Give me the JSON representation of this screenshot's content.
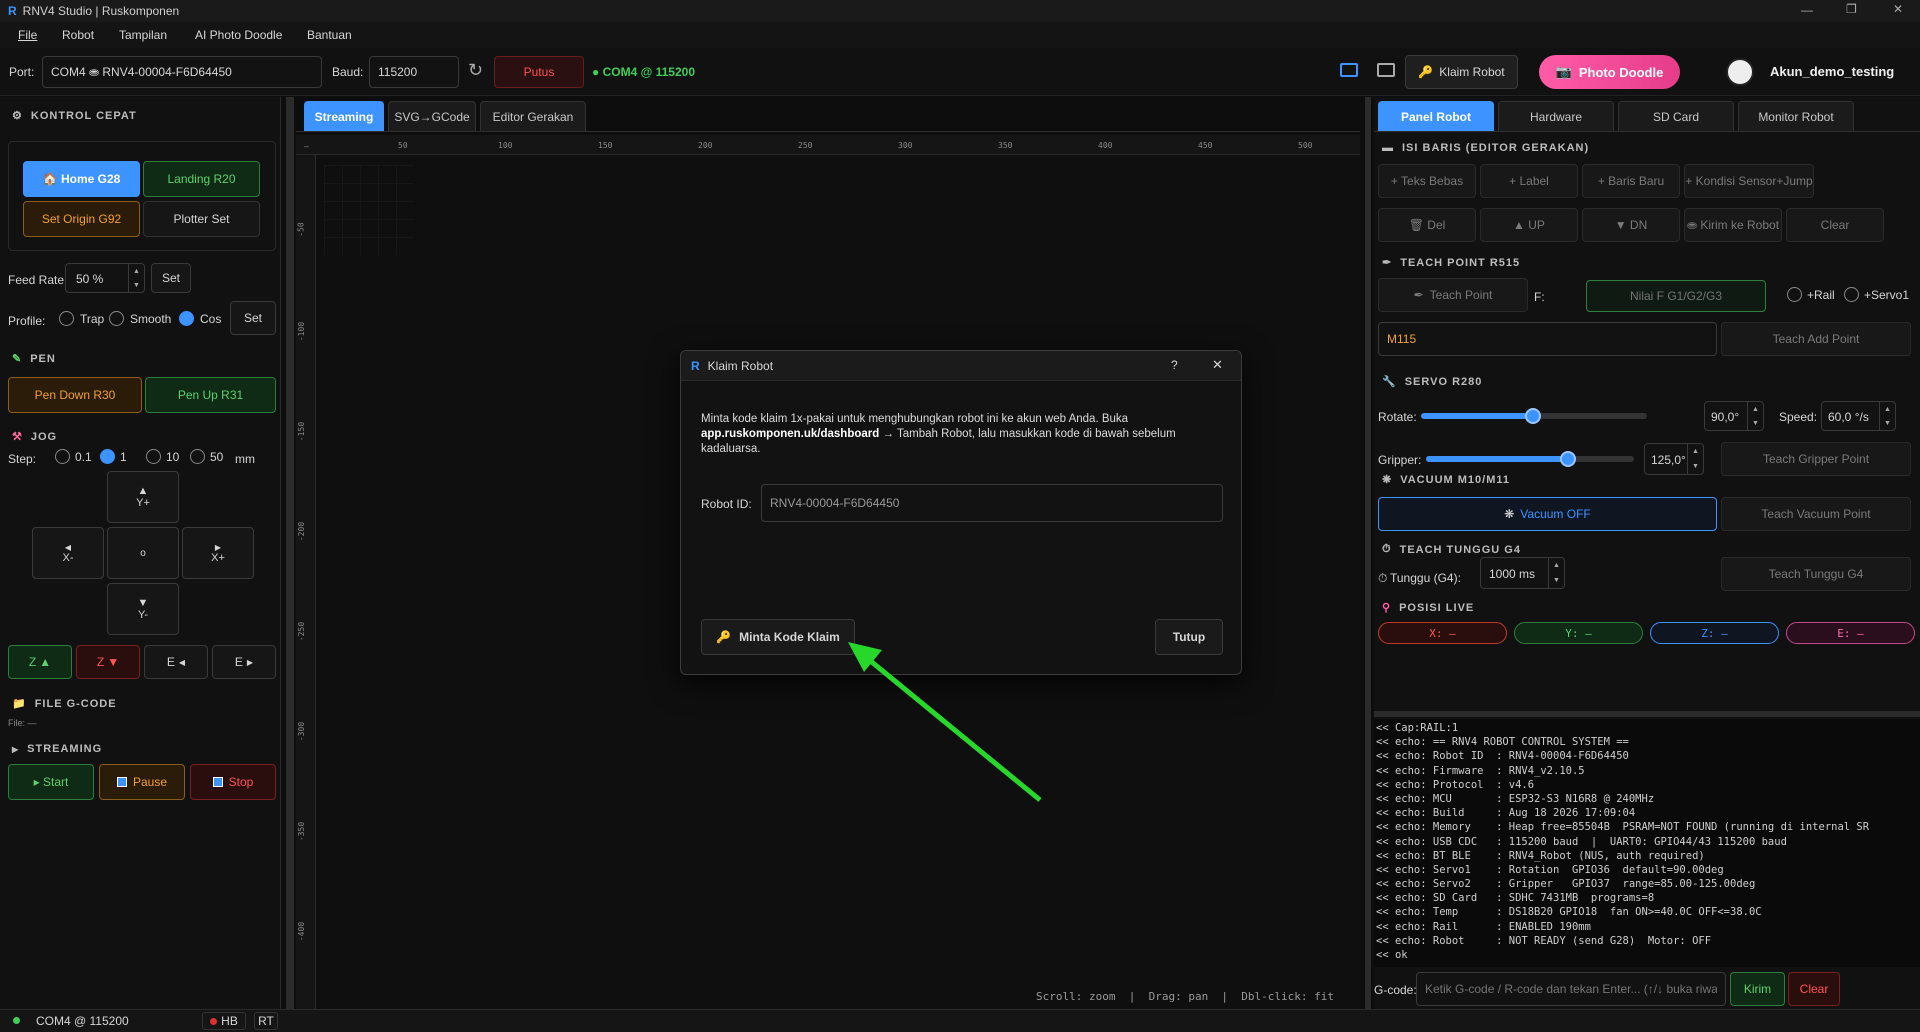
{
  "window": {
    "title": "RNV4 Studio | Ruskomponen"
  },
  "menu": [
    "File",
    "Robot",
    "Tampilan",
    "AI Photo Doodle",
    "Bantuan"
  ],
  "toolbar": {
    "port_label": "Port:",
    "port_value": "COM4  ⛂ RNV4-00004-F6D64450",
    "baud_label": "Baud:",
    "baud_value": "115200",
    "disconnect": "Putus",
    "status": "● COM4 @ 115200",
    "claim": "Klaim Robot",
    "doodle": "Photo Doodle",
    "account": "Akun_demo_testing"
  },
  "left": {
    "quick": "KONTROL CEPAT",
    "home": "🏠 Home  G28",
    "landing": "Landing  R20",
    "origin": "Set Origin  G92",
    "plotter": "Plotter Set",
    "feed_label": "Feed Rate:",
    "feed_value": "50 %",
    "set": "Set",
    "profile_label": "Profile:",
    "profiles": [
      "Trap",
      "Smooth",
      "Cos"
    ],
    "pen": "PEN",
    "pen_down": "Pen Down  R30",
    "pen_up": "Pen Up  R31",
    "jog": "JOG",
    "step_label": "Step:",
    "steps": [
      "0.1",
      "1",
      "10",
      "50"
    ],
    "unit": "mm",
    "yplus": "Y+",
    "xminus": "X-",
    "home_dot": "o",
    "xplus": "X+",
    "yminus": "Y-",
    "zup": "Z",
    "zdown": "Z",
    "eleft": "E",
    "eright": "E",
    "file": "FILE G-CODE",
    "file_name": "File: —",
    "streaming": "STREAMING",
    "start": "▸ Start",
    "pause": "Pause",
    "stop": "Stop"
  },
  "center": {
    "tabs": [
      "Streaming",
      "SVG→GCode",
      "Editor Gerakan"
    ],
    "hint": "Scroll: zoom  |  Drag: pan  |  Dbl-click: fit",
    "xticks": [
      "50",
      "100",
      "150",
      "200",
      "250",
      "300",
      "350",
      "400",
      "450",
      "500"
    ],
    "yticks": [
      "-50",
      "-100",
      "-150",
      "-200",
      "-250",
      "-300",
      "-350",
      "-400"
    ]
  },
  "dialog": {
    "title": "Klaim Robot",
    "help": "?",
    "close": "✕",
    "text1": "Minta kode klaim 1x-pakai untuk menghubungkan robot ini ke akun web Anda. Buka ",
    "link": "app.ruskomponen.uk/dashboard",
    "text2": " → Tambah Robot, lalu masukkan kode di bawah sebelum kadaluarsa.",
    "id_label": "Robot ID:",
    "id_value": "RNV4-00004-F6D64450",
    "request": "Minta Kode Klaim",
    "tutup": "Tutup"
  },
  "right": {
    "tabs": [
      "Panel Robot",
      "Hardware",
      "SD Card",
      "Monitor Robot"
    ],
    "isi": "ISI BARIS  (EDITOR GERAKAN)",
    "row1": [
      "+ Teks Bebas",
      "+ Label",
      "+ Baris Baru",
      "+ Kondisi Sensor+Jump"
    ],
    "row2": [
      "🗑 Del",
      "▲ UP",
      "▼ DN",
      "⛂ Kirim ke Robot",
      "Clear"
    ],
    "teach": "TEACH POINT  R515",
    "teach_btn": "Teach Point",
    "f_label": "F:",
    "f_placeholder": "Nilai F G1/G2/G3",
    "rail": "+Rail",
    "servo1": "+Servo1",
    "mvalue": "M115",
    "teach_add": "Teach Add Point",
    "servo": "SERVO  R280",
    "rotate": "Rotate:",
    "rotate_val": "90,0°",
    "speed": "Speed:",
    "speed_val": "60,0 °/s",
    "gripper": "Gripper:",
    "gripper_val": "125,0°",
    "teach_grip": "Teach Gripper Point",
    "vacuum": "VACUUM  M10/M11",
    "vac_btn": "Vacuum OFF",
    "teach_vac": "Teach Vacuum Point",
    "wait": "TEACH TUNGGU  G4",
    "wait_label": "Tunggu (G4):",
    "wait_val": "1000 ms",
    "teach_wait": "Teach Tunggu G4",
    "posisi": "POSISI LIVE",
    "pos": [
      "X: —",
      "Y: —",
      "Z: —",
      "E: —"
    ],
    "console": [
      "<< Cap:RAIL:1",
      "<< echo: == RNV4 ROBOT CONTROL SYSTEM ==",
      "<< echo: Robot ID  : RNV4-00004-F6D64450",
      "<< echo: Firmware  : RNV4_v2.10.5",
      "<< echo: Protocol  : v4.6",
      "<< echo: MCU       : ESP32-S3 N16R8 @ 240MHz",
      "<< echo: Build     : Aug 18 2026 17:09:04",
      "<< echo: Memory    : Heap free=85504B  PSRAM=NOT FOUND (running di internal SR",
      "<< echo: USB CDC   : 115200 baud  |  UART0: GPIO44/43 115200 baud",
      "<< echo: BT BLE    : RNV4_Robot (NUS, auth required)",
      "<< echo: Servo1    : Rotation  GPIO36  default=90.00deg",
      "<< echo: Servo2    : Gripper   GPIO37  range=85.00-125.00deg",
      "<< echo: SD Card   : SDHC 7431MB  programs=8",
      "<< echo: Temp      : DS18B20 GPIO18  fan ON>=40.0C OFF<=38.0C",
      "<< echo: Rail      : ENABLED 190mm",
      "<< echo: Robot     : NOT READY (send G28)  Motor: OFF",
      "<< ok"
    ],
    "gcode_label": "G-code:",
    "gcode_placeholder": "Ketik G-code / R-code dan tekan Enter... (↑/↓ buka riwayat comma...",
    "kirim": "Kirim",
    "clear": "Clear"
  },
  "statusbar": {
    "port": "COM4  @  115200",
    "hb": "HB",
    "rt": "RT"
  }
}
